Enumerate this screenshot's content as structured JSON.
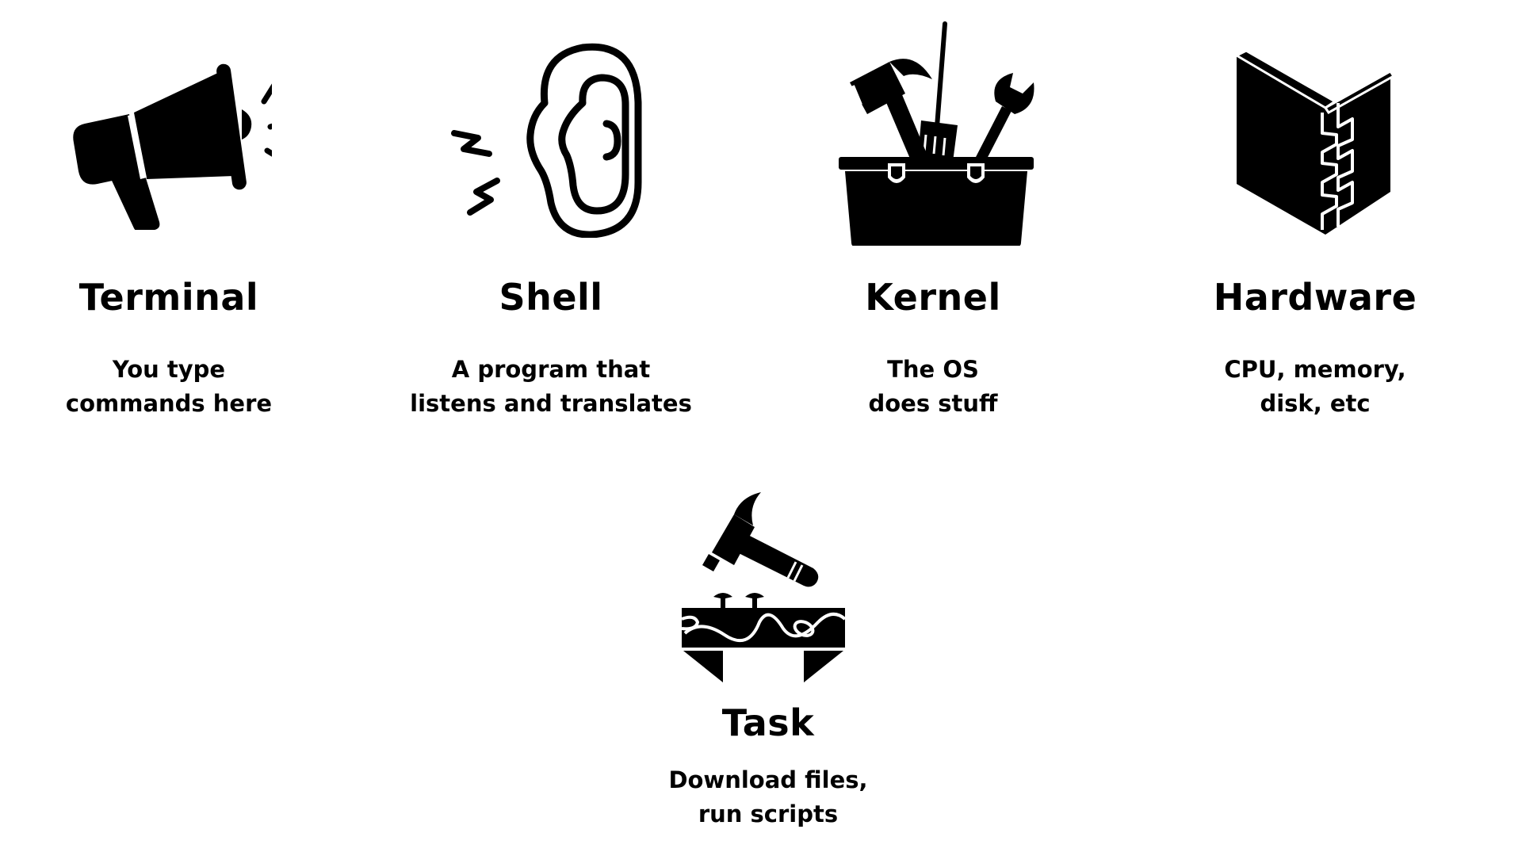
{
  "steps": [
    {
      "title": "Terminal",
      "desc_line1": "You type",
      "desc_line2": "commands here",
      "icon": "megaphone-icon"
    },
    {
      "title": "Shell",
      "desc_line1": "A program that",
      "desc_line2": "listens and translates",
      "icon": "ear-icon"
    },
    {
      "title": "Kernel",
      "desc_line1": "The OS",
      "desc_line2": "does stuff",
      "icon": "toolbox-icon"
    },
    {
      "title": "Hardware",
      "desc_line1": "CPU, memory,",
      "desc_line2": "disk, etc",
      "icon": "dovetail-joint-icon"
    },
    {
      "title": "Task",
      "desc_line1": "Download files,",
      "desc_line2": "run scripts",
      "icon": "hammer-workbench-icon"
    }
  ]
}
